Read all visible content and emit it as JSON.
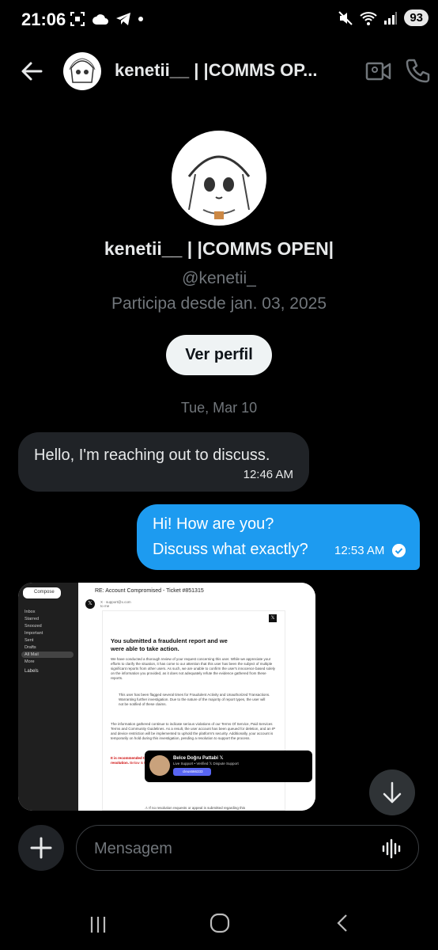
{
  "status_bar": {
    "time": "21:06",
    "battery": "93"
  },
  "header": {
    "name": "kenetii__ | |COMMS OP..."
  },
  "profile": {
    "name": "kenetii__ | |COMMS OPEN|",
    "handle": "@kenetii_",
    "joined": "Participa desde jan. 03, 2025",
    "view_profile_label": "Ver perfil"
  },
  "conversation": {
    "date_separator": "Tue, Mar 10",
    "messages": [
      {
        "direction": "incoming",
        "text": "Hello, I'm reaching out to discuss.",
        "time": "12:46 AM"
      },
      {
        "direction": "outgoing",
        "line1": "Hi! How are you?",
        "line2": "Discuss what exactly?",
        "time": "12:53 AM"
      }
    ],
    "attachment": {
      "gmail": {
        "compose": "Compose",
        "nav": [
          "Inbox",
          "Starred",
          "Snoozed",
          "Important",
          "Sent",
          "Drafts",
          "All Mail",
          "More"
        ],
        "active_nav": "All Mail",
        "labels": "Labels",
        "subject": "RE: Account Compromised - Ticket #851315",
        "from": "X  ·  support@x.com",
        "to": "to me"
      },
      "email": {
        "title": "You submitted a fraudulent report and we were able to take action.",
        "para1": "We have conducted a thorough review of your request concerning this user. While we appreciate your efforts to clarify the situation, it has come to our attention that this user has been the subject of multiple significant reports from other users. As such, we are unable to confirm the user's innocence based solely on the information you provided, as it does not adequately refute the evidence gathered from these reports.",
        "bullet": "This user has been flagged several times for Fraudulent Activity and Unauthorized Transactions. Warranting further investigation. Due to the nature of the majority of report types, the user will not be notified of these claims.",
        "para2": "The information gathered continue to indicate serious violations of our Terms Of Service, Paid Services Terms and Community Guidelines. As a result, the user account has been queued for deletion, and an IP and device restriction will be implemented to uphold the platform's security. Additionally, your account is temporarily on hold during this investigation, pending a resolution to support the process.",
        "red": "It is recommended that the user contact an Certified Dispute Staff within 12 hours for live case resolution.",
        "red_tail": "Below is the Contact information of the assigned staff currently managing this case.",
        "staff_name": "Belce Doğru Pattabi 𝕏",
        "staff_role": "Live Support • Verified 𝕏 Dispute Support",
        "staff_button": "cleus666333",
        "footer": "⚠ If no resolution requests or appeal is submitted regarding this"
      }
    }
  },
  "composer": {
    "placeholder": "Mensagem"
  },
  "colors": {
    "accent": "#1d9bf0",
    "incoming_bubble": "#202327",
    "secondary_text": "#71767b"
  }
}
